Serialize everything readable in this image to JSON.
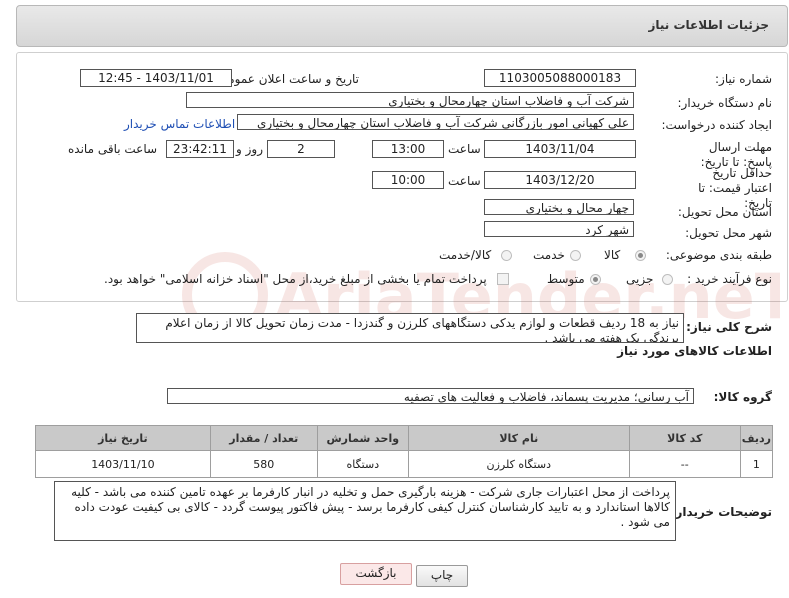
{
  "title": "جزئیات اطلاعات نیاز",
  "need_number": {
    "label": "شماره نیاز:",
    "value": "1103005088000183"
  },
  "announce": {
    "label": "تاریخ و ساعت اعلان عمومی:",
    "value": "1403/11/01 - 12:45"
  },
  "buyer_org": {
    "label": "نام دستگاه خریدار:",
    "value": "شرکت آب و فاضلاب استان چهارمحال و بختیاری"
  },
  "creator": {
    "label": "ایجاد کننده درخواست:",
    "value": "علی کهیانی امور بازرگانی شرکت آب و فاضلاب استان چهارمحال و بختیاری",
    "contact_link": "اطلاعات تماس خریدار"
  },
  "deadline": {
    "label": "مهلت ارسال پاسخ: تا تاریخ:",
    "date": "1403/11/04",
    "time_label": "ساعت",
    "time": "13:00",
    "days": "2",
    "days_label": "روز و",
    "remaining": "23:42:11",
    "remaining_label": "ساعت باقی مانده"
  },
  "validity": {
    "label": "حداقل تاریخ اعتبار قیمت: تا تاریخ:",
    "date": "1403/12/20",
    "time_label": "ساعت",
    "time": "10:00"
  },
  "province": {
    "label": "استان محل تحویل:",
    "value": "چهار محال و بختیاری"
  },
  "city": {
    "label": "شهر محل تحویل:",
    "value": "شهر کرد"
  },
  "category": {
    "label": "طبقه بندی موضوعی:",
    "options": [
      "کالا",
      "خدمت",
      "کالا/خدمت"
    ],
    "selected": "کالا"
  },
  "process": {
    "label": "نوع فرآیند خرید :",
    "options": [
      "جزیی",
      "متوسط"
    ],
    "note": "پرداخت تمام یا بخشی از مبلغ خرید،از محل \"اسناد خزانه اسلامی\" خواهد بود."
  },
  "description": {
    "label": "شرح کلی نیاز:",
    "value": "نیاز به 18 ردیف قطعات و لوازم یدکی دستگاههای کلرزن و گندزدا - مدت زمان تحویل کالا از زمان اعلام برندگی یک هفته می باشد ."
  },
  "goods_section": "اطلاعات کالاهای مورد نیاز",
  "goods_group": {
    "label": "گروه کالا:",
    "value": "آب رسانی؛ مدیریت پسماند، فاضلاب و فعالیت های تصفیه"
  },
  "table": {
    "headers": [
      "ردیف",
      "کد کالا",
      "نام کالا",
      "واحد شمارش",
      "تعداد / مقدار",
      "تاریخ نیاز"
    ],
    "rows": [
      [
        "1",
        "--",
        "دستگاه کلرزن",
        "دستگاه",
        "580",
        "1403/11/10"
      ]
    ]
  },
  "buyer_notes": {
    "label": "توضیحات خریدار:",
    "value": "پرداخت از محل اعتبارات جاری شرکت - هزینه بارگیری حمل و تخلیه در انبار کارفرما بر عهده تامین کننده می باشد - کلیه کالاها استاندارد و به تایید کارشناسان کنترل کیفی کارفرما برسد - پیش فاکتور پیوست گردد - کالای بی کیفیت عودت داده می شود ."
  },
  "buttons": {
    "print": "چاپ",
    "back": "بازگشت"
  },
  "watermark_text": "AriaTender.neT"
}
